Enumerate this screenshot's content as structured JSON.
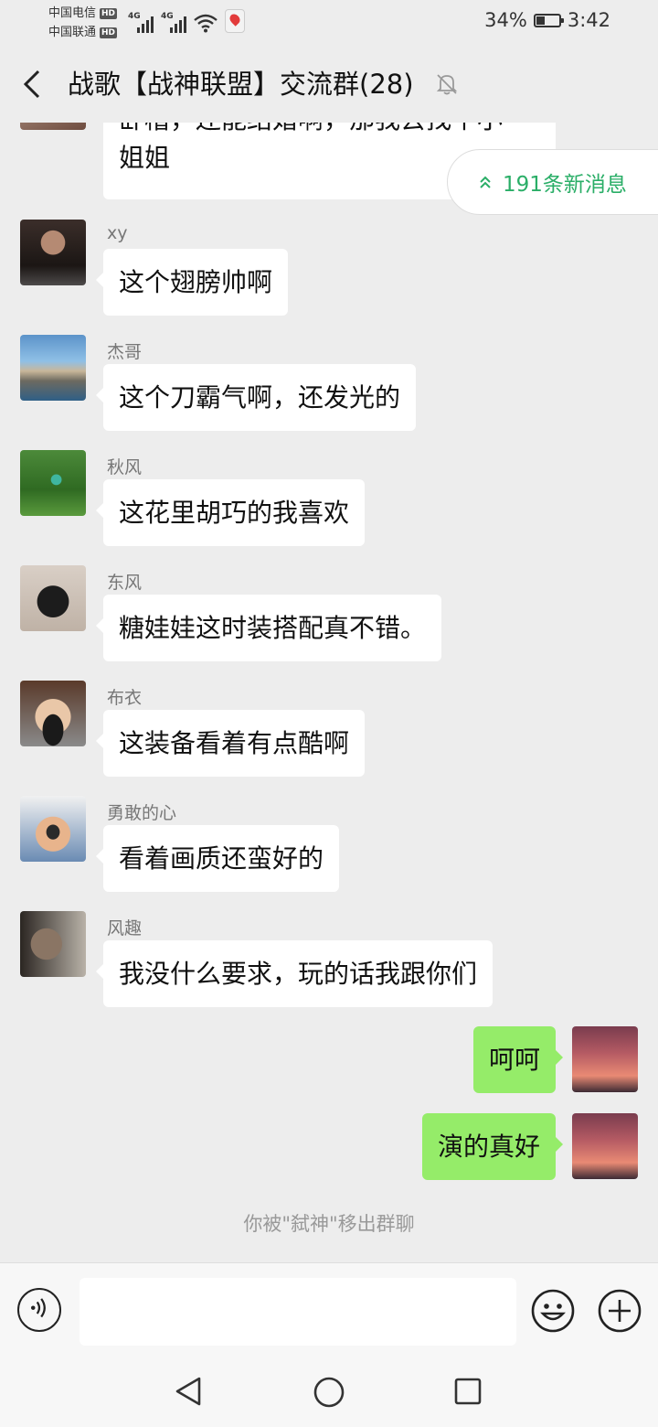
{
  "status_bar": {
    "carrier_1": "中国电信",
    "carrier_2": "中国联通",
    "hd_badge": "HD",
    "network_1": "4G",
    "network_2": "4G",
    "battery_text": "34%",
    "battery_level": 0.34,
    "time": "3:42"
  },
  "header": {
    "title": "战歌【战神联盟】交流群(28)",
    "muted": true
  },
  "new_messages_pill": "191条新消息",
  "partial_message": {
    "line1": "卧槽，还能结婚啊，那我去找个小",
    "line2": "姐姐"
  },
  "messages": [
    {
      "sender": "xy",
      "text": "这个翅膀帅啊",
      "avatar": "man-cigarette-avatar"
    },
    {
      "sender": "杰哥",
      "text": "这个刀霸气啊，还发光的",
      "avatar": "city-skyline-avatar"
    },
    {
      "sender": "秋风",
      "text": "这花里胡巧的我喜欢",
      "avatar": "golfer-avatar"
    },
    {
      "sender": "东风",
      "text": "糖娃娃这时装搭配真不错。",
      "avatar": "black-cat-avatar"
    },
    {
      "sender": "布衣",
      "text": "这装备看着有点酷啊",
      "avatar": "masked-cartoon-avatar"
    },
    {
      "sender": "勇敢的心",
      "text": "看着画质还蛮好的",
      "avatar": "glasses-cartoon-avatar"
    },
    {
      "sender": "风趣",
      "text": "我没什么要求，玩的话我跟你们",
      "avatar": "bearded-man-avatar"
    }
  ],
  "my_messages": [
    {
      "text": "呵呵"
    },
    {
      "text": "演的真好"
    }
  ],
  "system_notice": "你被\"弑神\"移出群聊",
  "colors": {
    "background": "#ededed",
    "my_bubble": "#95ec69",
    "accent_green": "#2aae67"
  }
}
